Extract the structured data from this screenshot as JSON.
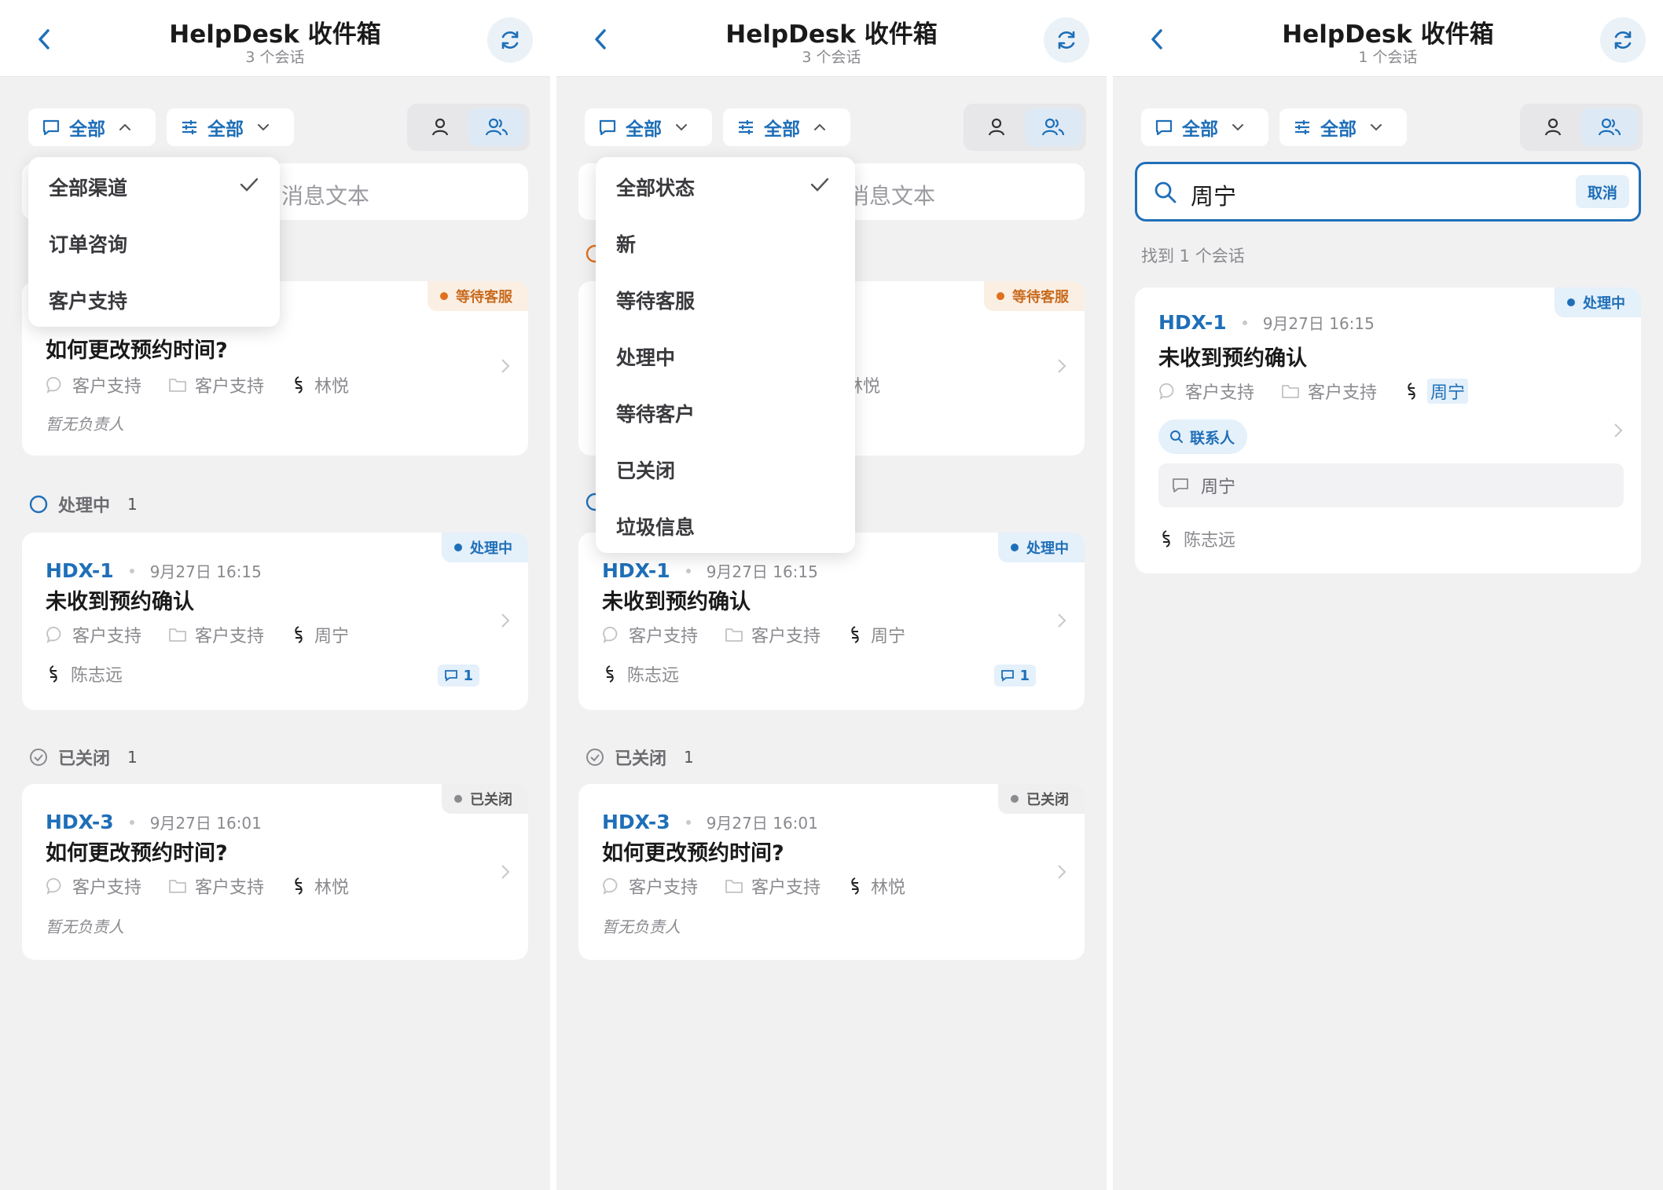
{
  "app": {
    "title": "HelpDesk 收件箱"
  },
  "panels": [
    {
      "subtitle": "3 个会话",
      "channel_filter": "全部",
      "status_filter": "全部",
      "search_placeholder": "消息文本",
      "dropdown": {
        "items": [
          "全部渠道",
          "订单咨询",
          "客户支持"
        ],
        "selected": "全部渠道"
      },
      "sections": [
        {
          "label": "处理中",
          "count": "1"
        },
        {
          "label": "已关闭",
          "count": "1"
        }
      ],
      "cards": [
        {
          "badge": "等待客服",
          "title": "如何更改预约时间?",
          "channel": "客户支持",
          "inbox": "客户支持",
          "contact": "林悦",
          "assignee": "暂无负责人"
        },
        {
          "badge": "处理中",
          "id": "HDX-1",
          "time": "9月27日 16:15",
          "title": "未收到预约确认",
          "channel": "客户支持",
          "inbox": "客户支持",
          "contact": "周宁",
          "assignee": "陈志远",
          "messages": "1"
        },
        {
          "badge": "已关闭",
          "id": "HDX-3",
          "time": "9月27日 16:01",
          "title": "如何更改预约时间?",
          "channel": "客户支持",
          "inbox": "客户支持",
          "contact": "林悦",
          "assignee": "暂无负责人"
        }
      ]
    },
    {
      "subtitle": "3 个会话",
      "channel_filter": "全部",
      "status_filter": "全部",
      "search_placeholder": "消息文本",
      "dropdown": {
        "items": [
          "全部状态",
          "新",
          "等待客服",
          "处理中",
          "等待客户",
          "已关闭",
          "垃圾信息"
        ],
        "selected": "全部状态"
      },
      "sections": [
        {
          "label": "已关闭",
          "count": "1"
        }
      ],
      "cards": [
        {
          "badge": "等待客服",
          "contact": "林悦"
        },
        {
          "badge": "处理中",
          "id": "HDX-1",
          "time": "9月27日 16:15",
          "title": "未收到预约确认",
          "channel": "客户支持",
          "inbox": "客户支持",
          "contact": "周宁",
          "assignee": "陈志远",
          "messages": "1"
        },
        {
          "badge": "已关闭",
          "id": "HDX-3",
          "time": "9月27日 16:01",
          "title": "如何更改预约时间?",
          "channel": "客户支持",
          "inbox": "客户支持",
          "contact": "林悦",
          "assignee": "暂无负责人"
        }
      ]
    },
    {
      "subtitle": "1 个会话",
      "channel_filter": "全部",
      "status_filter": "全部",
      "search_value": "周宁",
      "cancel_label": "取消",
      "result_count": "找到 1 个会话",
      "card": {
        "badge": "处理中",
        "id": "HDX-1",
        "time": "9月27日 16:15",
        "title": "未收到预约确认",
        "channel": "客户支持",
        "inbox": "客户支持",
        "contact": "周宁",
        "match_chip": "联系人",
        "match_text": "周宁",
        "assignee": "陈志远"
      }
    }
  ],
  "colors": {
    "accent": "#1f6fb8",
    "waiting": "#c86a1c",
    "background": "#f1f1f2"
  }
}
